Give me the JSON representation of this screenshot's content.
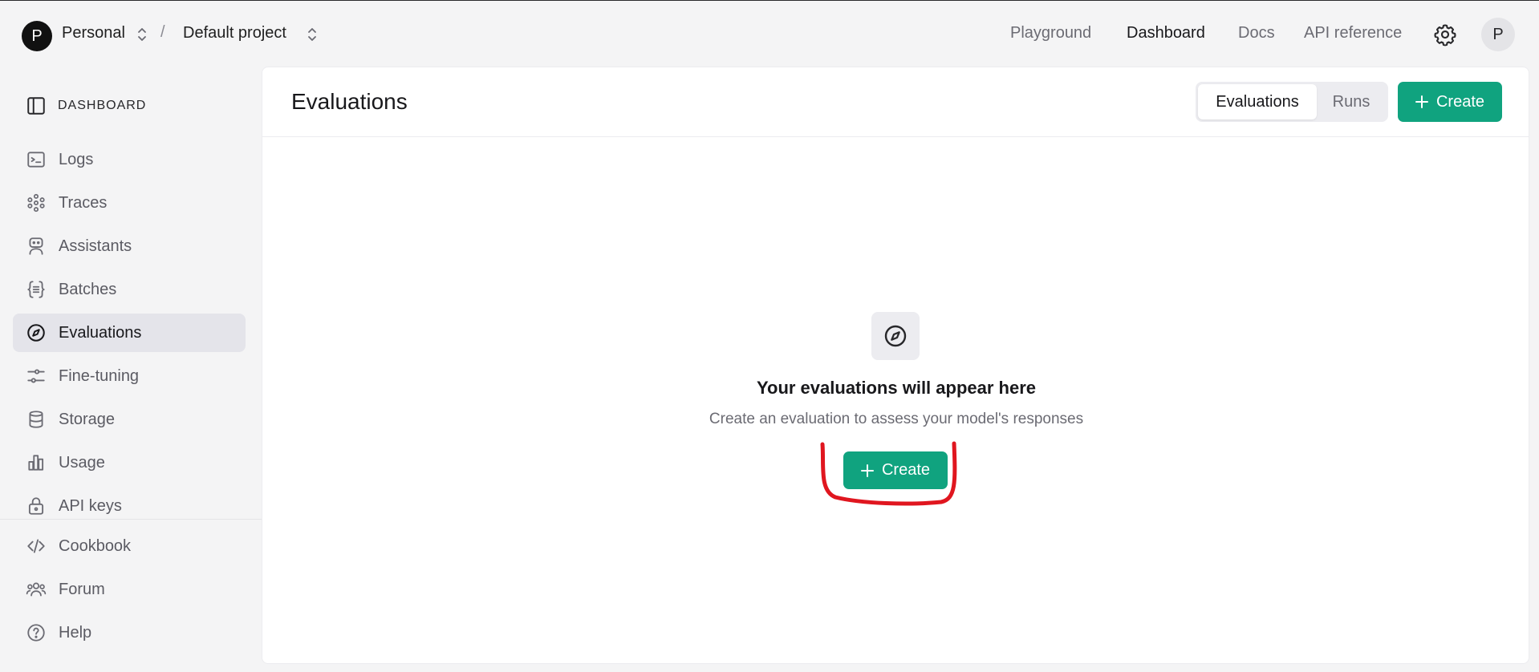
{
  "header": {
    "org_initial": "P",
    "org_name": "Personal",
    "separator": "/",
    "project_name": "Default project",
    "nav": [
      "Playground",
      "Dashboard",
      "Docs",
      "API reference"
    ],
    "active_nav": "Dashboard",
    "user_initial": "P"
  },
  "sidebar": {
    "section_label": "DASHBOARD",
    "items": [
      {
        "label": "Logs",
        "icon": "terminal-icon"
      },
      {
        "label": "Traces",
        "icon": "traces-icon"
      },
      {
        "label": "Assistants",
        "icon": "robot-icon"
      },
      {
        "label": "Batches",
        "icon": "braces-icon"
      },
      {
        "label": "Evaluations",
        "icon": "compass-icon",
        "active": true
      },
      {
        "label": "Fine-tuning",
        "icon": "sliders-icon"
      },
      {
        "label": "Storage",
        "icon": "database-icon"
      },
      {
        "label": "Usage",
        "icon": "bar-chart-icon"
      },
      {
        "label": "API keys",
        "icon": "lock-icon"
      }
    ],
    "footer_items": [
      {
        "label": "Cookbook",
        "icon": "code-icon"
      },
      {
        "label": "Forum",
        "icon": "users-icon"
      },
      {
        "label": "Help",
        "icon": "help-icon"
      }
    ]
  },
  "main": {
    "title": "Evaluations",
    "tabs": [
      "Evaluations",
      "Runs"
    ],
    "active_tab": "Evaluations",
    "create_label": "Create",
    "empty_state": {
      "title": "Your evaluations will appear here",
      "subtitle": "Create an evaluation to assess your model's responses",
      "button_label": "Create"
    }
  },
  "colors": {
    "accent": "#10a37f",
    "annotation": "#e0161f"
  }
}
